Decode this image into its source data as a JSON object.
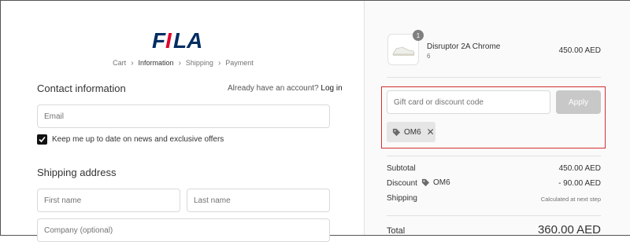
{
  "brand": {
    "name": "FILA",
    "navy": "#002d62",
    "red": "#e4002b"
  },
  "breadcrumb": {
    "items": [
      {
        "label": "Cart",
        "state": "link"
      },
      {
        "label": "Information",
        "state": "current"
      },
      {
        "label": "Shipping",
        "state": "upcoming"
      },
      {
        "label": "Payment",
        "state": "upcoming"
      }
    ],
    "separator_icon": "chevron-right-icon"
  },
  "contact": {
    "title": "Contact information",
    "account_prompt": "Already have an account?",
    "login_label": "Log in",
    "email_placeholder": "Email",
    "newsletter_label": "Keep me up to date on news and exclusive offers",
    "newsletter_checked": true
  },
  "shipping": {
    "title": "Shipping address",
    "first_name_placeholder": "First name",
    "last_name_placeholder": "Last name",
    "company_placeholder": "Company (optional)"
  },
  "order": {
    "item": {
      "name": "Disruptor 2A Chrome",
      "variant": "6",
      "quantity": "1",
      "price": "450.00 AED"
    },
    "discount_input_placeholder": "Gift card or discount code",
    "apply_label": "Apply",
    "applied_code": "OM6",
    "tag_icon": "tag-icon",
    "remove_icon": "close-icon",
    "highlight_color": "#d32f2f",
    "summary": {
      "subtotal_label": "Subtotal",
      "subtotal_value": "450.00 AED",
      "discount_label": "Discount",
      "discount_code": "OM6",
      "discount_value": "- 90.00 AED",
      "shipping_label": "Shipping",
      "shipping_value": "Calculated at next step",
      "total_label": "Total",
      "total_value": "360.00 AED"
    }
  }
}
